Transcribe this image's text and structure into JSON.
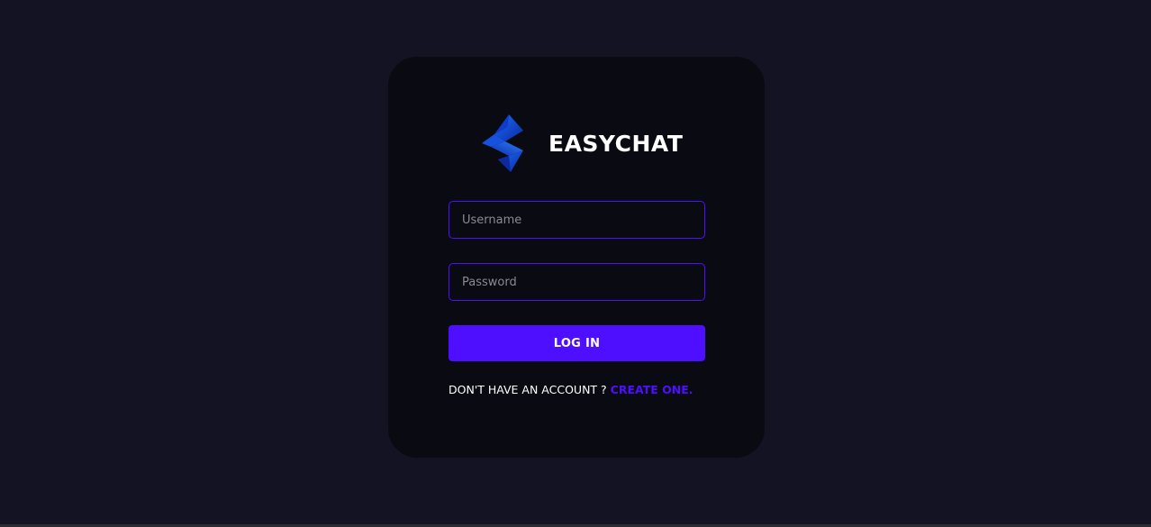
{
  "app": {
    "name": "EASYCHAT",
    "logo_icon": "easychat-logo-icon"
  },
  "form": {
    "username_placeholder": "Username",
    "username_value": "",
    "password_placeholder": "Password",
    "password_value": "",
    "login_label": "LOG IN",
    "signup_prompt": "DON'T HAVE AN ACCOUNT ? ",
    "signup_link": "CREATE ONE."
  },
  "colors": {
    "background": "#131324",
    "card": "#0a0a12",
    "accent": "#4e0eff",
    "text": "#ffffff",
    "placeholder": "#8a8a96"
  }
}
